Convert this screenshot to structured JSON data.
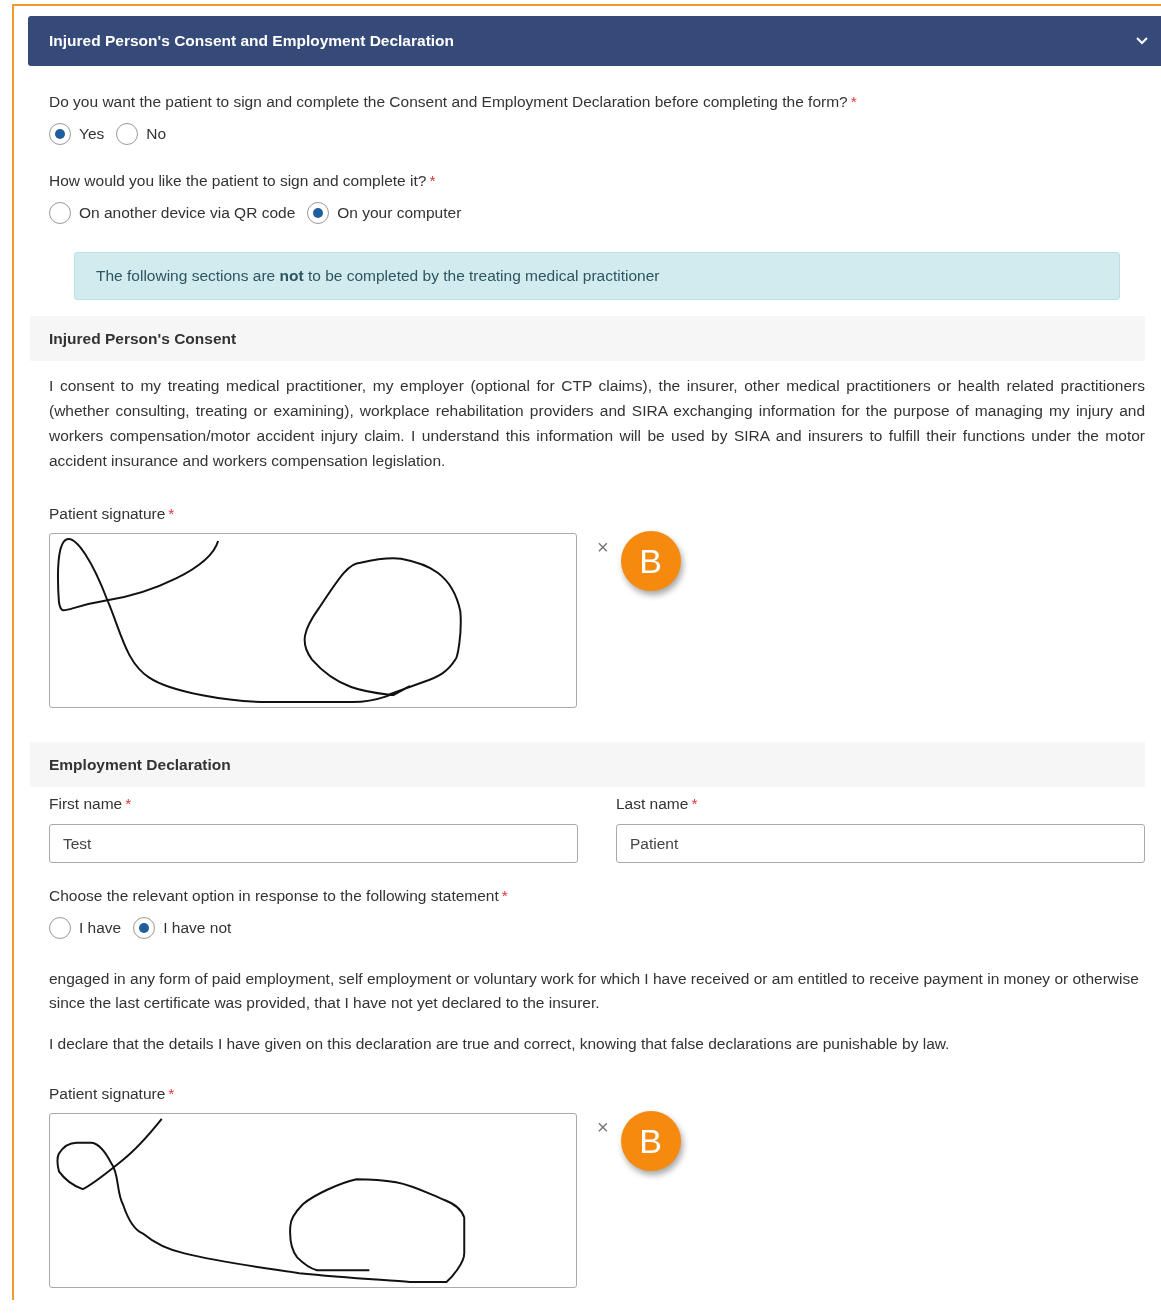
{
  "panel": {
    "title": "Injured Person's Consent and Employment Declaration",
    "expanded": true
  },
  "questions": [
    {
      "label": "Do you want the patient to sign and complete the Consent and Employment Declaration before completing the form?",
      "required": "*",
      "options": [
        {
          "label": "Yes",
          "selected": true
        },
        {
          "label": "No",
          "selected": false
        }
      ]
    },
    {
      "label": "How would you like the patient to sign and complete it?",
      "required": "*",
      "options": [
        {
          "label": "On another device via QR code",
          "selected": false
        },
        {
          "label": "On your computer",
          "selected": true
        }
      ]
    }
  ],
  "alert": "The following sections are **not** to be completed by the treating medical practitioner",
  "consent": {
    "heading": "Injured Person's Consent",
    "text": "I consent to my treating medical practitioner, my employer (optional for CTP claims), the insurer, other medical practitioners or health related practitioners (whether consulting, treating or examining), workplace rehabilitation providers and SIRA exchanging information for the purpose of managing my injury and workers compensation/motor accident injury claim. I understand this information will be used by SIRA and insurers to fulfill their functions under the motor accident insurance and workers compensation legislation.",
    "signature": {
      "label": "Patient signature",
      "required": "*",
      "clear": "×",
      "badge": "B"
    }
  },
  "employment": {
    "heading": "Employment Declaration",
    "fields": [
      {
        "label": "First name",
        "required": "*",
        "value": "Test"
      },
      {
        "label": "Last name",
        "required": "*",
        "value": "Patient"
      }
    ],
    "question": {
      "label": "Choose the relevant option in response to the following statement",
      "required": "*",
      "options": [
        {
          "label": "I have",
          "selected": false
        },
        {
          "label": "I have not",
          "selected": true
        }
      ]
    },
    "statement": "engaged in any form of paid employment, self employment or voluntary work for which I have received or am entitled to receive payment in money or otherwise since the last certificate was provided, that I have not yet declared to the insurer.",
    "declaration": "I declare that the details I have given on this declaration are true and correct, knowing that false declarations are punishable by law.",
    "signature": {
      "label": "Patient signature",
      "required": "*",
      "clear": "×",
      "badge": "B"
    }
  }
}
